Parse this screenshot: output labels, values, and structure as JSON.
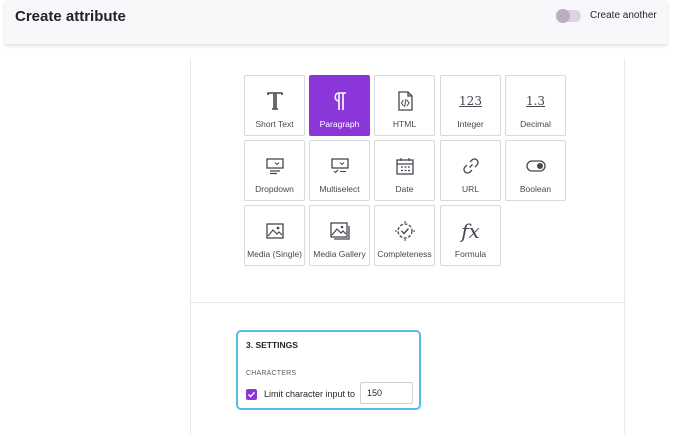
{
  "header": {
    "title": "Create attribute",
    "create_another_label": "Create another",
    "create_another_on": false
  },
  "attribute_types": [
    {
      "label": "Short Text",
      "icon": "short-text-icon",
      "selected": false
    },
    {
      "label": "Paragraph",
      "icon": "paragraph-icon",
      "selected": true
    },
    {
      "label": "HTML",
      "icon": "html-icon",
      "selected": false
    },
    {
      "label": "Integer",
      "icon": "integer-icon",
      "glyph": "123",
      "selected": false
    },
    {
      "label": "Decimal",
      "icon": "decimal-icon",
      "glyph": "1.3",
      "selected": false
    },
    {
      "label": "Dropdown",
      "icon": "dropdown-icon",
      "selected": false
    },
    {
      "label": "Multiselect",
      "icon": "multiselect-icon",
      "selected": false
    },
    {
      "label": "Date",
      "icon": "calendar-icon",
      "selected": false
    },
    {
      "label": "URL",
      "icon": "link-icon",
      "selected": false
    },
    {
      "label": "Boolean",
      "icon": "toggle-icon",
      "selected": false
    },
    {
      "label": "Media (Single)",
      "icon": "image-icon",
      "selected": false
    },
    {
      "label": "Media Gallery",
      "icon": "gallery-icon",
      "selected": false
    },
    {
      "label": "Completeness",
      "icon": "completeness-icon",
      "selected": false
    },
    {
      "label": "Formula",
      "icon": "formula-icon",
      "glyph": "fx",
      "selected": false
    }
  ],
  "settings": {
    "title": "3. SETTINGS",
    "section_label": "CHARACTERS",
    "limit_label": "Limit character input to",
    "limit_checked": true,
    "limit_value": "150"
  },
  "colors": {
    "accent": "#8a36d8",
    "focus_border": "#52bde5"
  }
}
